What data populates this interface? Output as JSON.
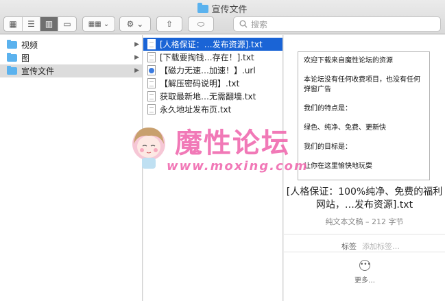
{
  "window": {
    "title": "宣传文件"
  },
  "toolbar": {
    "views": [
      {
        "name": "icon-view-icon",
        "glyph": "▦",
        "active": false
      },
      {
        "name": "list-view-icon",
        "glyph": "☰",
        "active": false
      },
      {
        "name": "column-view-icon",
        "glyph": "▥",
        "active": true
      },
      {
        "name": "gallery-view-icon",
        "glyph": "▭",
        "active": false
      }
    ],
    "group_glyph": "▦▦ ⌄",
    "action_glyph": "⚙ ⌄",
    "share_glyph": "⇧",
    "tag_glyph": "⬭",
    "search_placeholder": "搜索"
  },
  "sidebar_column": {
    "items": [
      {
        "label": "视频"
      },
      {
        "label": "图"
      },
      {
        "label": "宣传文件"
      }
    ]
  },
  "files_column": {
    "items": [
      {
        "label": "[人格保证：…发布资源].txt",
        "type": "txt"
      },
      {
        "label": "[下载要掏钱…存在！].txt",
        "type": "txt"
      },
      {
        "label": "【磁力无速…加速！】.url",
        "type": "url"
      },
      {
        "label": "【解压密码说明】.txt",
        "type": "txt"
      },
      {
        "label": "获取最新地…无需翻墙.txt",
        "type": "txt"
      },
      {
        "label": "永久地址发布页.txt",
        "type": "txt"
      }
    ]
  },
  "preview": {
    "lines": [
      "欢迎下载来自魔性论坛的资源",
      "本论坛没有任何收费项目，也没有任何弹窗广告",
      "我们的特点是：",
      "绿色、纯净、免费、更新快",
      "我们的目标是：",
      "让你在这里愉快地玩耍"
    ],
    "title": "[人格保证：100%纯净、免费的福利网站，…发布资源].txt",
    "subtitle": "纯文本文稿 – 212 字节",
    "tags_label": "标签",
    "tags_placeholder": "添加标签…",
    "more_label": "更多…"
  },
  "watermark": {
    "text": "魔性论坛",
    "url": "www.moxing.com"
  },
  "colors": {
    "selection_blue": "#1a64d6",
    "folder_blue": "#5bb2ee",
    "watermark_pink": "#f06bb0"
  }
}
